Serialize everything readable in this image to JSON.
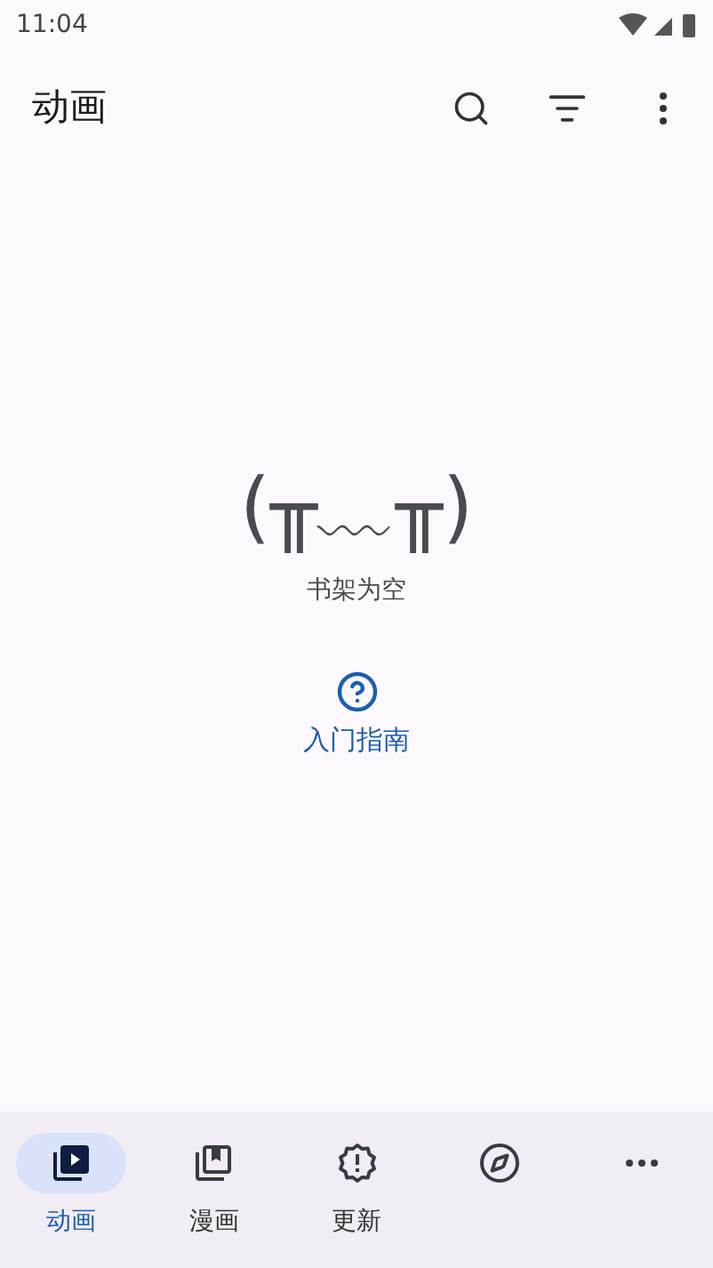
{
  "status_bar": {
    "time": "11:04"
  },
  "top_bar": {
    "title": "动画"
  },
  "empty_state": {
    "face": "(╥﹏╥)",
    "message": "书架为空",
    "link": "入门指南"
  },
  "bottom_nav": [
    {
      "kind": "library-play",
      "label": "动画",
      "selected": true
    },
    {
      "kind": "library-book",
      "label": "漫画",
      "selected": false
    },
    {
      "kind": "updates",
      "label": "更新",
      "selected": false
    },
    {
      "kind": "browse",
      "selected": false
    },
    {
      "kind": "more",
      "selected": false
    }
  ]
}
